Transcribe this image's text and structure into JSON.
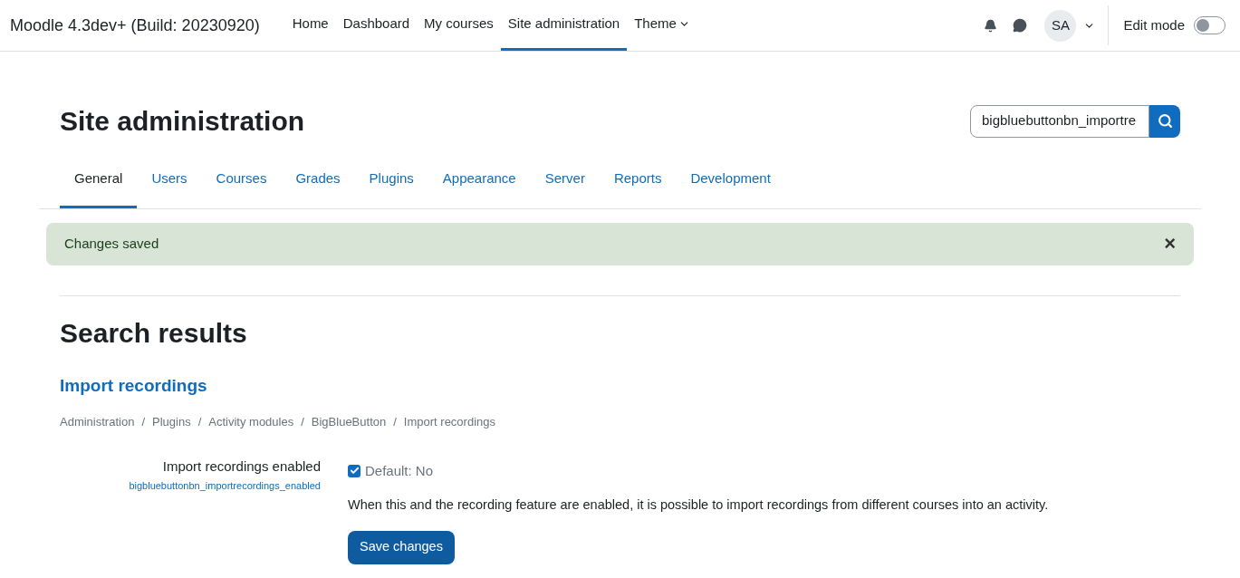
{
  "navbar": {
    "site_name": "Moodle 4.3dev+ (Build: 20230920)",
    "items": [
      {
        "label": "Home",
        "selected": false,
        "dropdown": false
      },
      {
        "label": "Dashboard",
        "selected": false,
        "dropdown": false
      },
      {
        "label": "My courses",
        "selected": false,
        "dropdown": false
      },
      {
        "label": "Site administration",
        "selected": true,
        "dropdown": false
      },
      {
        "label": "Theme",
        "selected": false,
        "dropdown": true
      }
    ],
    "avatar": "SA",
    "edit_mode": {
      "label": "Edit mode",
      "on": false
    }
  },
  "header": {
    "title": "Site administration",
    "search": {
      "value": "bigbluebuttonbn_importre"
    }
  },
  "tabs": [
    {
      "label": "General",
      "selected": true
    },
    {
      "label": "Users",
      "selected": false
    },
    {
      "label": "Courses",
      "selected": false
    },
    {
      "label": "Grades",
      "selected": false
    },
    {
      "label": "Plugins",
      "selected": false
    },
    {
      "label": "Appearance",
      "selected": false
    },
    {
      "label": "Server",
      "selected": false
    },
    {
      "label": "Reports",
      "selected": false
    },
    {
      "label": "Development",
      "selected": false
    }
  ],
  "alert": {
    "message": "Changes saved",
    "close": "×"
  },
  "results": {
    "title": "Search results",
    "section": "Import recordings",
    "breadcrumb": [
      {
        "label": "Administration"
      },
      {
        "separator": "/",
        "label": "Plugins"
      },
      {
        "separator": "/",
        "label": "Activity modules"
      },
      {
        "separator": "/",
        "label": "BigBlueButton"
      },
      {
        "separator": "/",
        "label": "Import recordings"
      }
    ],
    "setting": {
      "label": "Import recordings enabled",
      "key": "bigbluebuttonbn_importrecordings_enabled",
      "checked": true,
      "default": "Default: No",
      "description": "When this and the recording feature are enabled, it is possible to import recordings from different courses into an activity."
    },
    "save": "Save changes"
  }
}
